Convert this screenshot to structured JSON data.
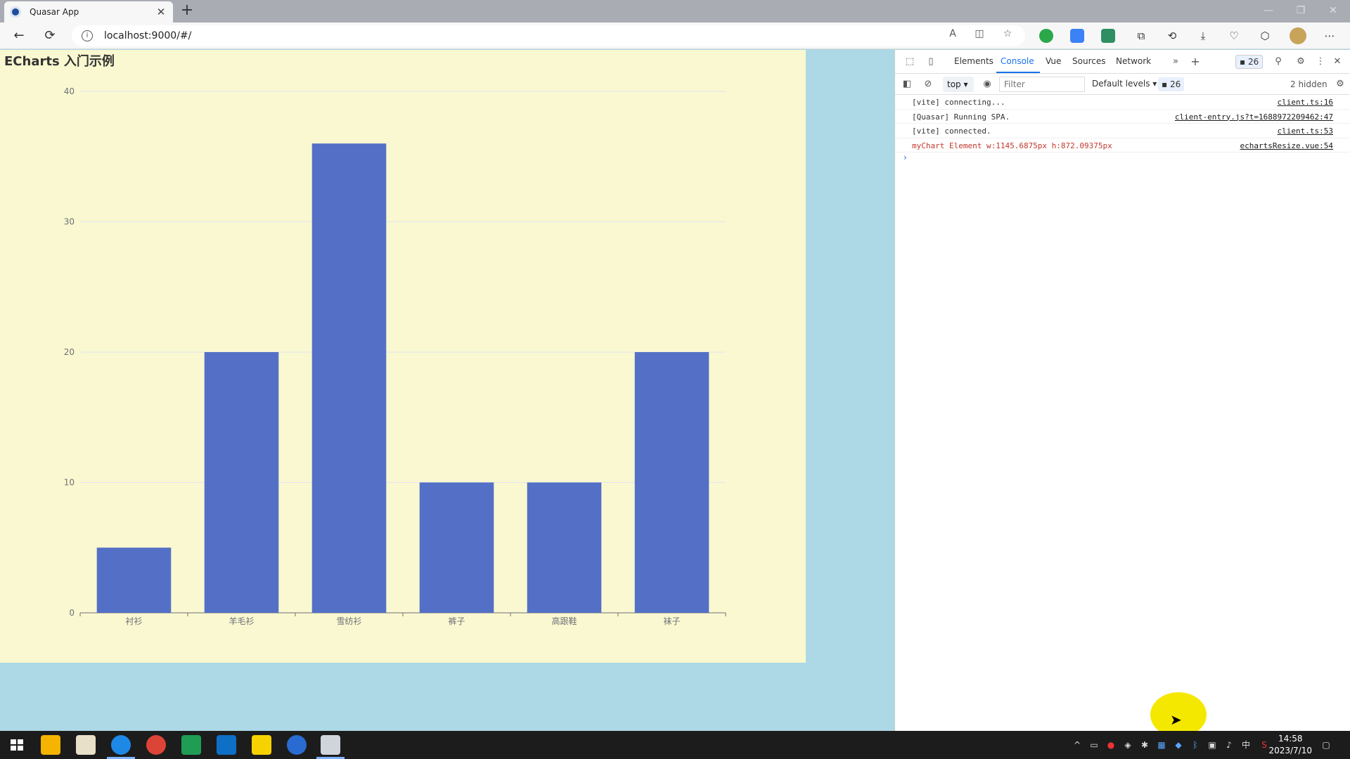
{
  "browser": {
    "tab_title": "Quasar App",
    "url": "localhost:9000/#/"
  },
  "page": {
    "chart_title": "ECharts 入门示例"
  },
  "chart_data": {
    "type": "bar",
    "title": "ECharts 入门示例",
    "categories": [
      "衬衫",
      "羊毛衫",
      "雪纺衫",
      "裤子",
      "高跟鞋",
      "袜子"
    ],
    "values": [
      5,
      20,
      36,
      10,
      10,
      20
    ],
    "ylim": [
      0,
      40
    ],
    "yticks": [
      "0",
      "10",
      "20",
      "30",
      "40"
    ],
    "bar_color": "#5470c6",
    "grid": true,
    "xlabel": "",
    "ylabel": ""
  },
  "devtools": {
    "tabs": [
      "Elements",
      "Console",
      "Vue",
      "Sources",
      "Network"
    ],
    "active_tab": "Console",
    "badge_count": "26",
    "context": "top",
    "filter_placeholder": "Filter",
    "levels": "Default levels",
    "badge_count2": "26",
    "hidden": "2 hidden",
    "logs": [
      {
        "msg": "[vite] connecting...",
        "src": "client.ts:16"
      },
      {
        "msg": "[Quasar] Running SPA.",
        "src": "client-entry.js?t=1688972209462:47"
      },
      {
        "msg": "[vite] connected.",
        "src": "client.ts:53"
      },
      {
        "msg": "myChart Element  w:1145.6875px  h:872.09375px",
        "src": "echartsResize.vue:54"
      }
    ]
  },
  "taskbar": {
    "time": "14:58",
    "date": "2023/7/10",
    "ime": "中"
  },
  "colors": {
    "chart_bg": "#f9f8d0",
    "page_bg": "#add8e6",
    "bar": "#5470c6"
  }
}
